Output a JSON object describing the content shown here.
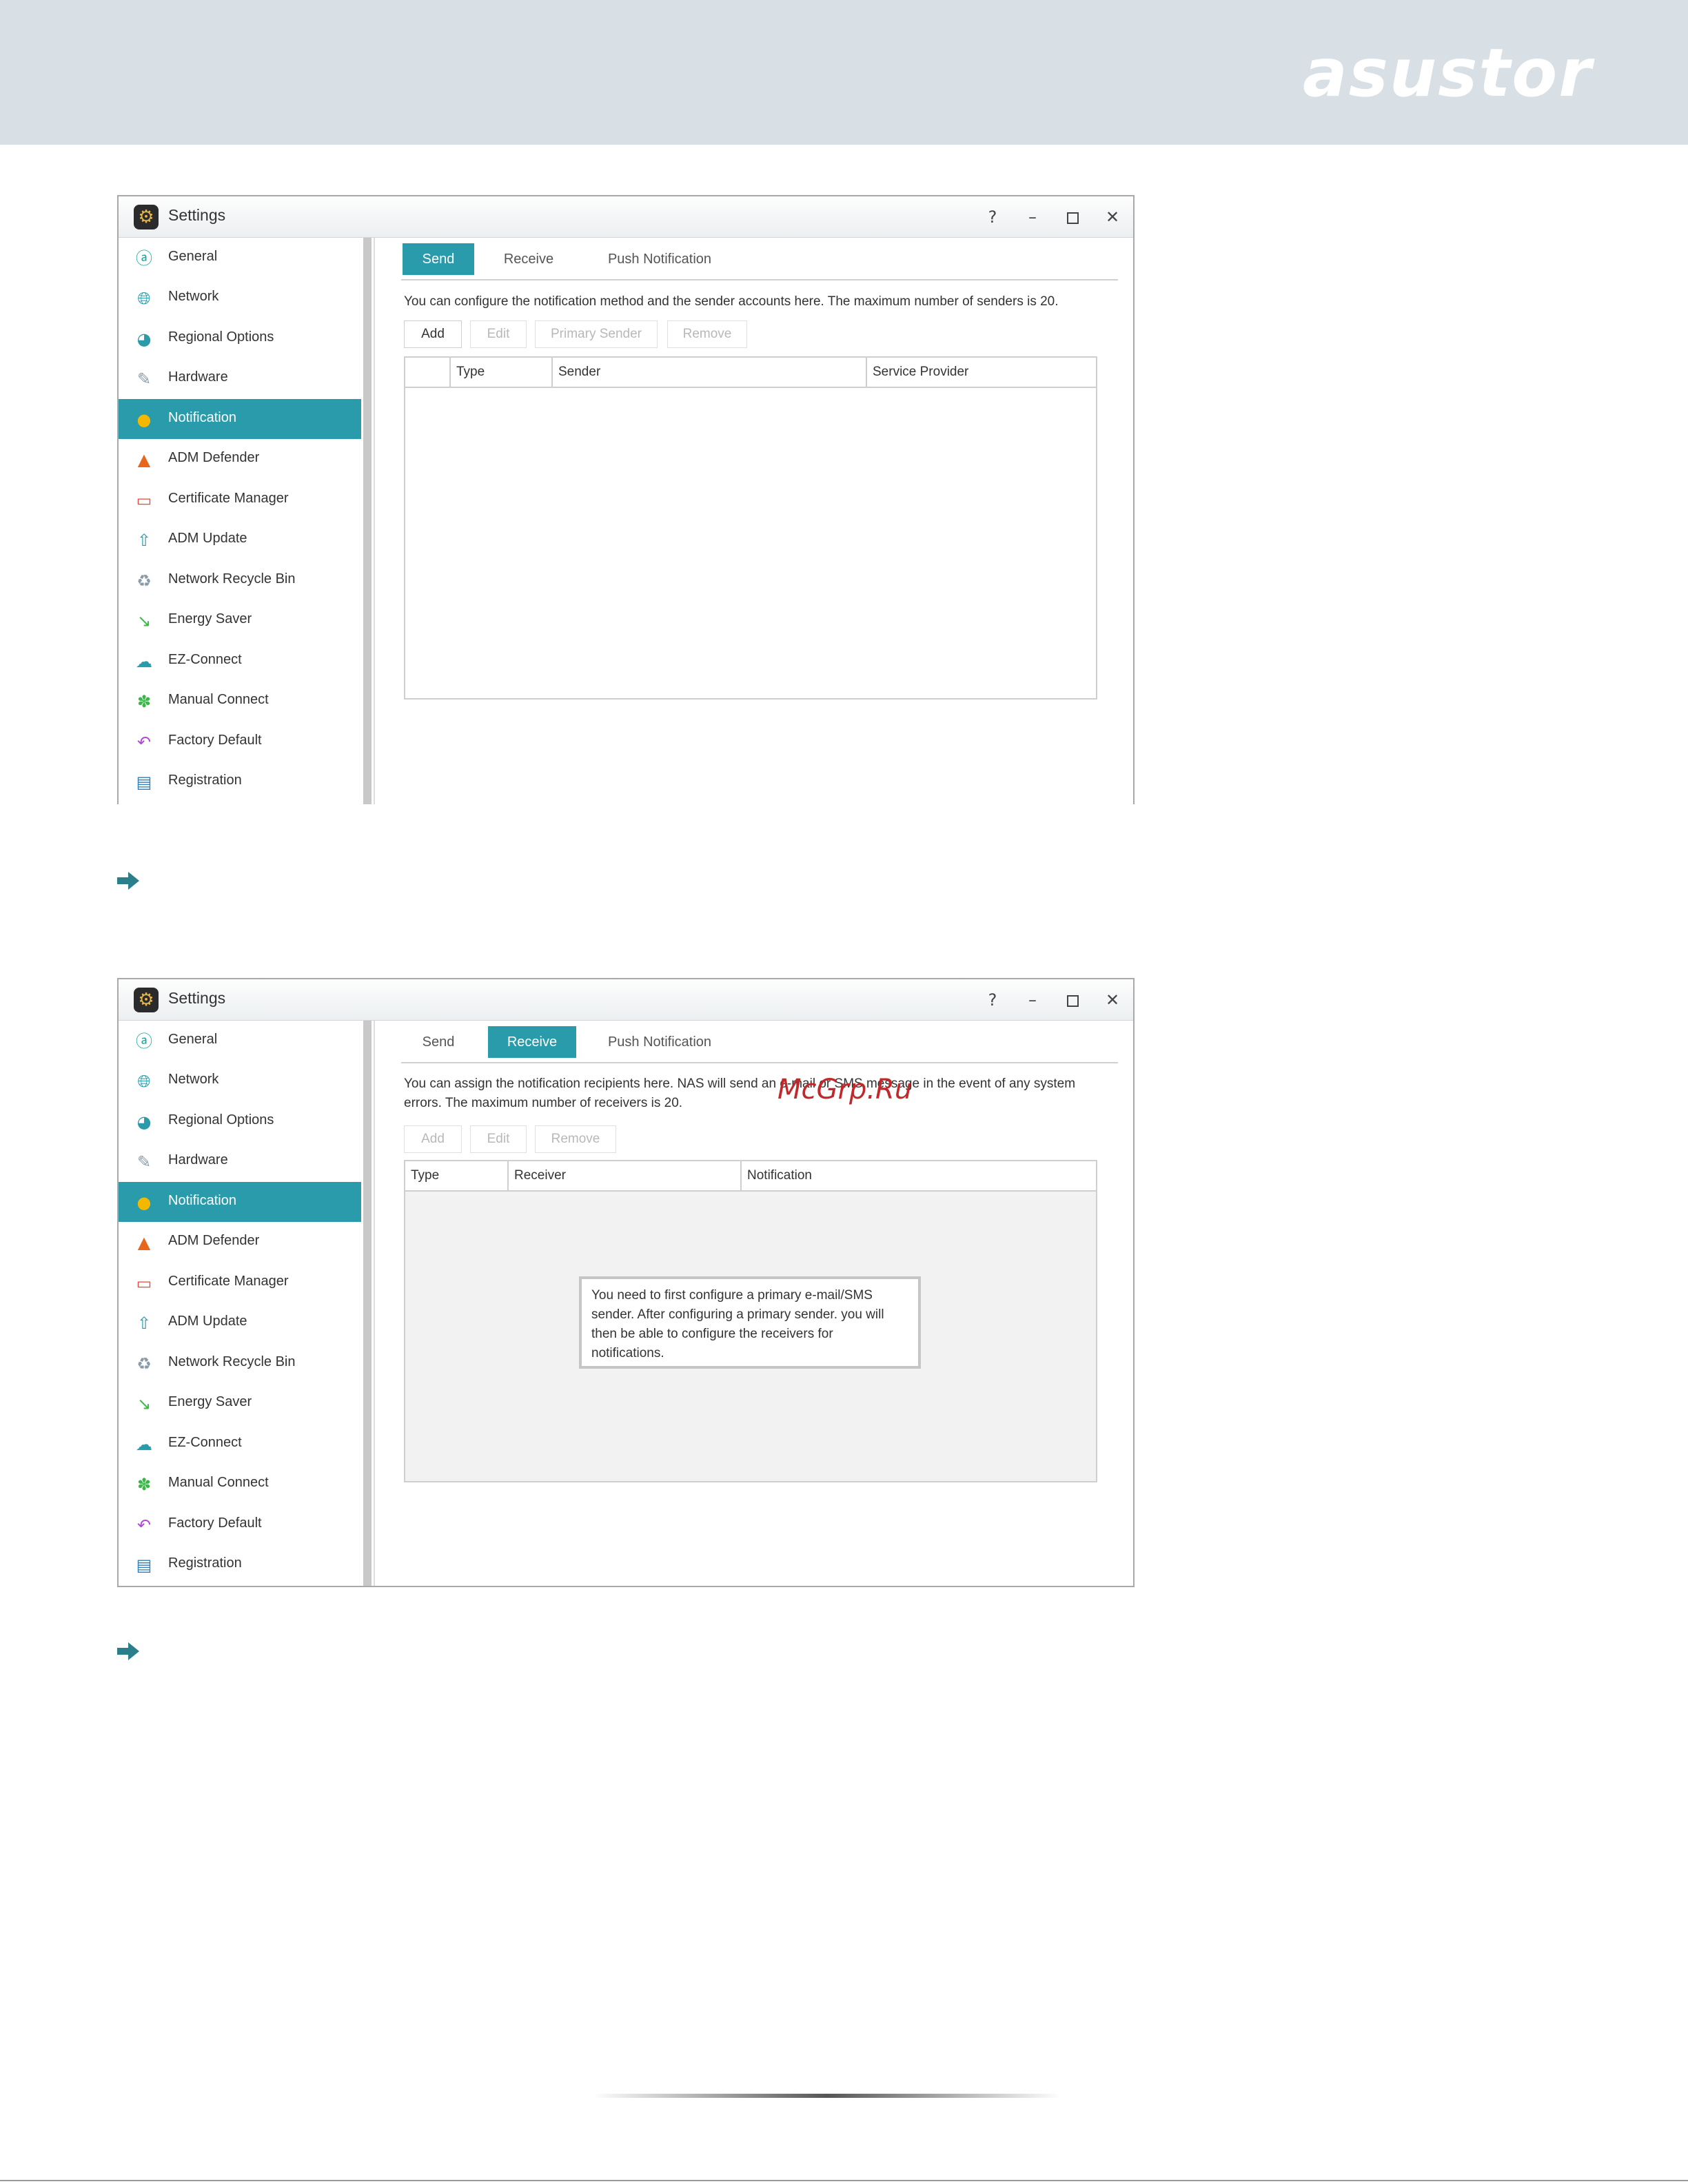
{
  "brand": "asustor",
  "watermark": "McGrp.Ru",
  "window_title": "Settings",
  "window_controls": {
    "help": "?",
    "minimize": "–",
    "close": "✕"
  },
  "sidebar_items": [
    {
      "label": "General",
      "icon": "general-icon"
    },
    {
      "label": "Network",
      "icon": "globe-icon"
    },
    {
      "label": "Regional Options",
      "icon": "regional-icon"
    },
    {
      "label": "Hardware",
      "icon": "wrench-icon"
    },
    {
      "label": "Notification",
      "icon": "alert-icon"
    },
    {
      "label": "ADM Defender",
      "icon": "firewall-icon"
    },
    {
      "label": "Certificate Manager",
      "icon": "certificate-icon"
    },
    {
      "label": "ADM Update",
      "icon": "update-icon"
    },
    {
      "label": "Network Recycle Bin",
      "icon": "recycle-bin-icon"
    },
    {
      "label": "Energy Saver",
      "icon": "energy-icon"
    },
    {
      "label": "EZ-Connect",
      "icon": "cloud-icon"
    },
    {
      "label": "Manual Connect",
      "icon": "manual-connect-icon"
    },
    {
      "label": "Factory Default",
      "icon": "undo-icon"
    },
    {
      "label": "Registration",
      "icon": "registration-icon"
    }
  ],
  "tabs": [
    "Send",
    "Receive",
    "Push Notification"
  ],
  "send_panel": {
    "description": "You can configure the notification method and the sender accounts here. The maximum number of senders is 20.",
    "buttons": {
      "add": "Add",
      "edit": "Edit",
      "primary_sender": "Primary Sender",
      "remove": "Remove"
    },
    "columns": [
      "",
      "Type",
      "Sender",
      "Service Provider"
    ]
  },
  "receive_panel": {
    "description": "You can assign the notification recipients here. NAS will send an e-mail or SMS message in the event of any system errors. The maximum number of receivers is 20.",
    "buttons": {
      "add": "Add",
      "edit": "Edit",
      "remove": "Remove"
    },
    "columns": [
      "Type",
      "Receiver",
      "Notification"
    ],
    "tip": "You need to first configure a primary e-mail/SMS sender. After configuring a primary sender. you will then be able to configure the receivers for notifications."
  },
  "colors": {
    "accent": "#2a9bab",
    "banner": "#d8e0e5",
    "arrow": "#2a7f8a"
  }
}
